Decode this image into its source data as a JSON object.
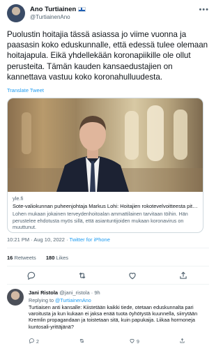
{
  "tweet": {
    "author_name": "Ano Turtiainen",
    "author_handle": "@TurtiainenAno",
    "text": "Puolustin hoitajia tässä asiassa jo viime vuonna ja paasasin koko eduskunnalle, että edessä tulee olemaan hoitajapula. Eikä yhdellekään koronapiikille ole ollut perusteita. Tämän kauden kansaedustajien on kannettava vastuu koko koronahulluudesta.",
    "translate_label": "Translate Tweet",
    "timestamp": "10:21 PM · Aug 10, 2022",
    "client": "Twitter for iPhone",
    "retweets_count": "16",
    "retweets_label": "Retweets",
    "likes_count": "180",
    "likes_label": "Likes"
  },
  "card": {
    "domain": "yle.fi",
    "title": "Sote-valiokunnan puheenjohtaja Markus Lohi: Hoitajien rokotevelvoitteesta pitäisi luopua",
    "description": "Lohen mukaan jokainen terveydenhoitoalan ammattilainen tarvitaan töihin. Hän perustelee ehdotusta myös sillä, että asiantuntijoiden mukaan koronavirus on muuttunut."
  },
  "icons": {
    "more": "more-icon",
    "reply": "reply-icon",
    "retweet": "retweet-icon",
    "like": "like-icon",
    "share": "share-icon"
  },
  "reply": {
    "author_name": "Jani Ristola",
    "author_handle": "@jani_ristola",
    "time": "9h",
    "replying_prefix": "Replying to",
    "replying_to": "@TurtiainenAno",
    "text": "Turtiaisen anti kansalle: Kiistetään kaikki tiede, otetaan eduskunnalta pari varoitusta ja kun kukaan ei jaksa enää tuota öyhötystä kuunnella, siirrytään Kremlin propagandaan ja toistetaan sitä, kuin papukaija. Liikaa hormoneja kuntosali-yrittäjänä?",
    "reply_count": "2",
    "retweet_count": "",
    "like_count": "9"
  },
  "colors": {
    "accent": "#1d9bf0",
    "text_primary": "#0f1419",
    "text_secondary": "#536471",
    "border": "#cfd9de"
  }
}
